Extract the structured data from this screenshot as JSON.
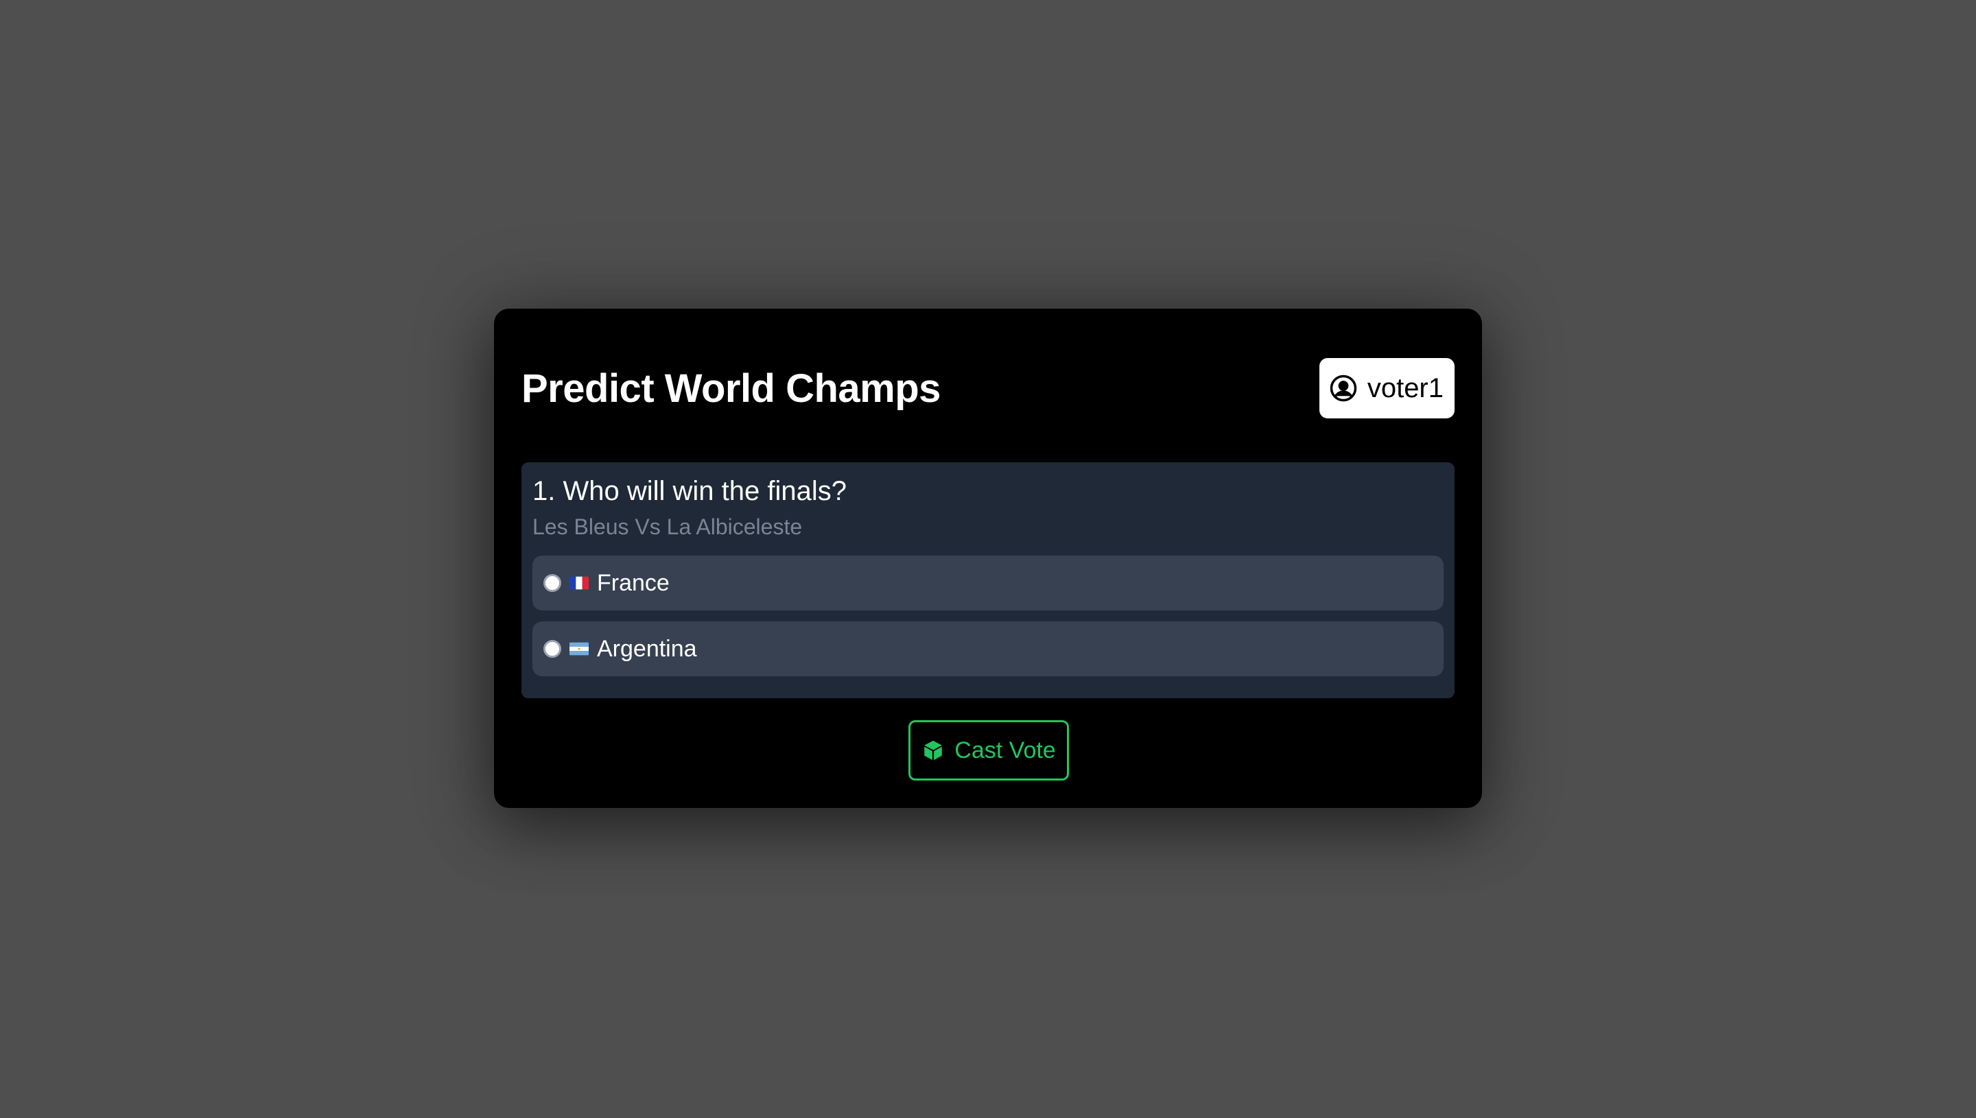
{
  "app": {
    "title": "Predict World Champs"
  },
  "user": {
    "name": "voter1",
    "icon": "user-circle-icon"
  },
  "question": {
    "title": "1. Who will win the finals?",
    "subtitle": "Les Bleus Vs La Albiceleste",
    "options": [
      {
        "label": "France",
        "flag": "flag-france-icon",
        "selected": false
      },
      {
        "label": "Argentina",
        "flag": "flag-argentina-icon",
        "selected": false
      }
    ]
  },
  "actions": {
    "cast_vote_label": "Cast Vote",
    "cast_vote_icon": "cube-icon"
  },
  "colors": {
    "page_background": "#4f4f4f",
    "card_background": "#000000",
    "question_background": "#1f2937",
    "option_background": "#374151",
    "subtitle_text": "#7b8494",
    "accent_green": "#22c55e"
  }
}
